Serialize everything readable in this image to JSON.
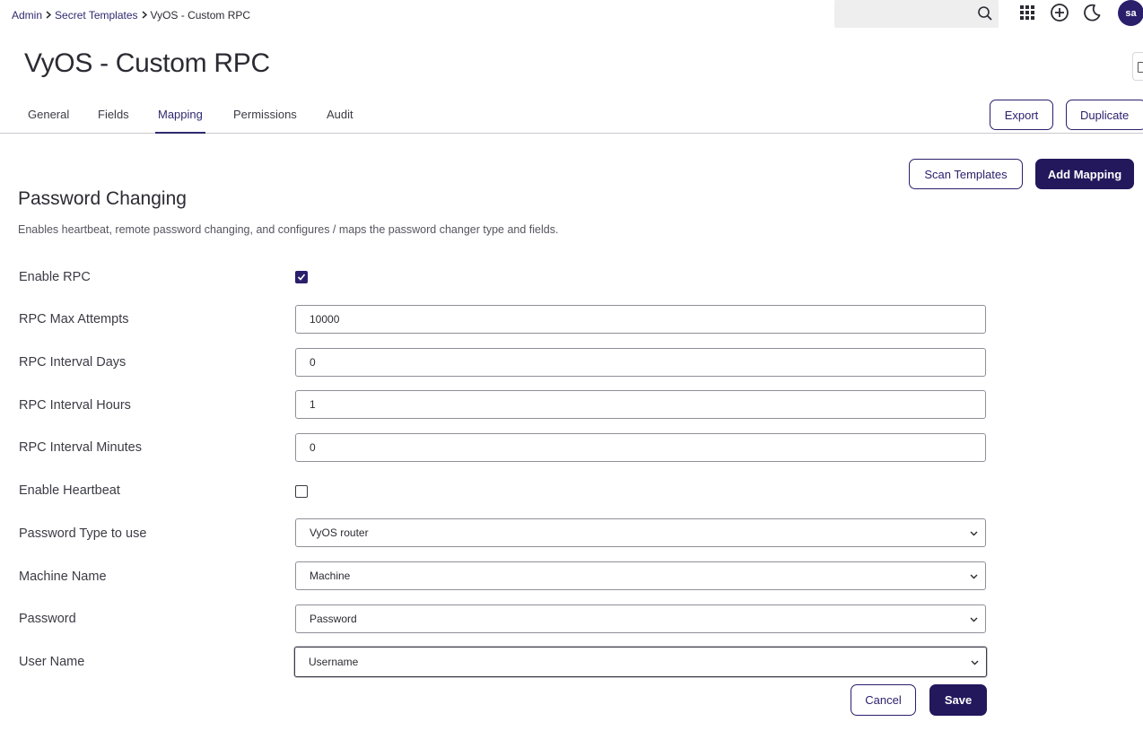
{
  "breadcrumb": {
    "items": [
      "Admin",
      "Secret Templates"
    ],
    "current": "VyOS - Custom RPC"
  },
  "header": {
    "avatar_initials": "sa"
  },
  "page": {
    "title": "VyOS - Custom RPC"
  },
  "tabs": [
    {
      "label": "General"
    },
    {
      "label": "Fields"
    },
    {
      "label": "Mapping",
      "active": true
    },
    {
      "label": "Permissions"
    },
    {
      "label": "Audit"
    }
  ],
  "actions": {
    "export_label": "Export",
    "duplicate_label": "Duplicate",
    "scan_templates_label": "Scan Templates",
    "add_mapping_label": "Add Mapping"
  },
  "section": {
    "title": "Password Changing",
    "description": "Enables heartbeat, remote password changing, and configures / maps the password changer type and fields."
  },
  "form": {
    "enable_rpc": {
      "label": "Enable RPC",
      "checked": true
    },
    "rpc_max_attempts": {
      "label": "RPC Max Attempts",
      "value": "10000"
    },
    "rpc_interval_days": {
      "label": "RPC Interval Days",
      "value": "0"
    },
    "rpc_interval_hours": {
      "label": "RPC Interval Hours",
      "value": "1"
    },
    "rpc_interval_minutes": {
      "label": "RPC Interval Minutes",
      "value": "0"
    },
    "enable_heartbeat": {
      "label": "Enable Heartbeat",
      "checked": false
    },
    "password_type": {
      "label": "Password Type to use",
      "value": "VyOS router"
    },
    "machine_name": {
      "label": "Machine Name",
      "value": "Machine"
    },
    "password": {
      "label": "Password",
      "value": "Password"
    },
    "user_name": {
      "label": "User Name",
      "value": "Username"
    }
  },
  "footer": {
    "cancel_label": "Cancel",
    "save_label": "Save"
  },
  "colors": {
    "primary": "#23185c",
    "link": "#2e2a6e"
  }
}
